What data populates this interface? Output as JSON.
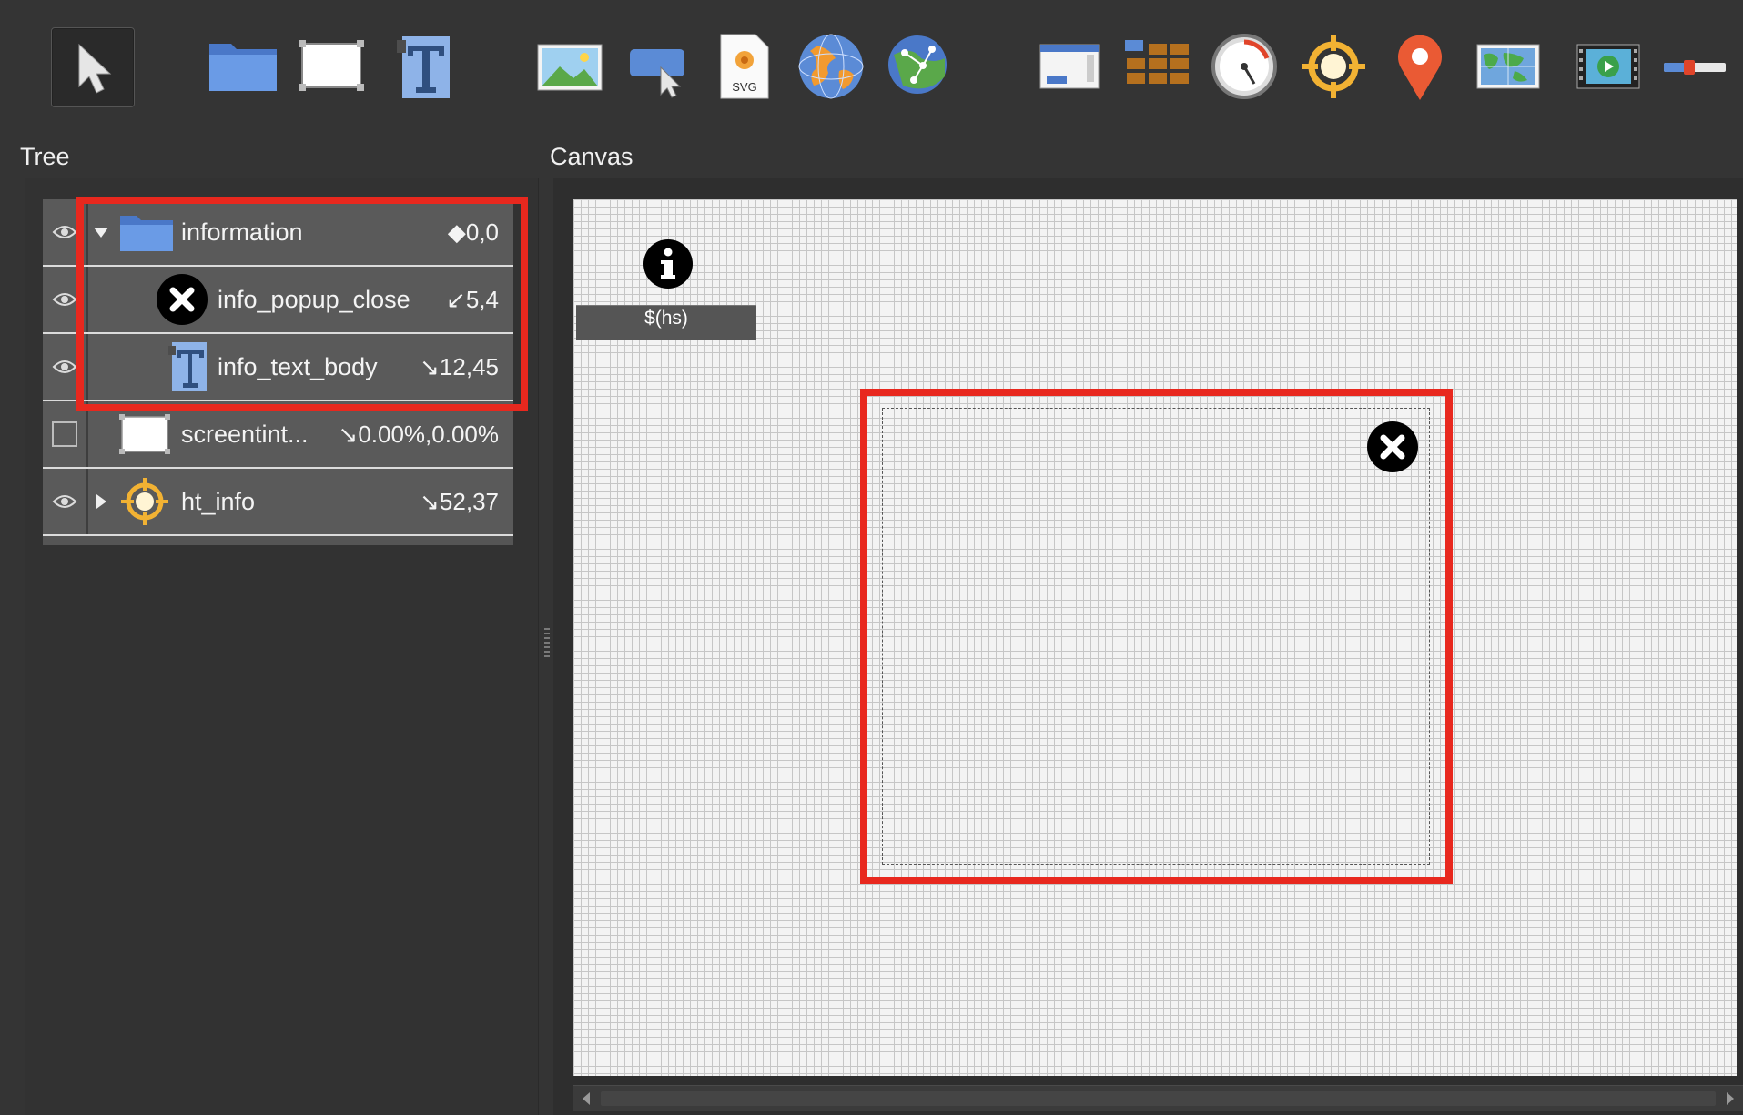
{
  "toolbar": {
    "tools": [
      {
        "name": "pointer-tool",
        "icon": "arrow-pointer-icon",
        "active": true
      },
      {
        "name": "folder-tool",
        "icon": "folder-icon"
      },
      {
        "name": "rectangle-tool",
        "icon": "rectangle-icon"
      },
      {
        "name": "text-tool",
        "icon": "text-icon"
      },
      {
        "name": "image-tool",
        "icon": "image-icon"
      },
      {
        "name": "button-tool",
        "icon": "button-click-icon"
      },
      {
        "name": "svg-tool",
        "icon": "svg-file-icon",
        "label": "SVG"
      },
      {
        "name": "globe-tool",
        "icon": "globe-icon"
      },
      {
        "name": "map-node-tool",
        "icon": "node-map-icon"
      },
      {
        "name": "window-tool",
        "icon": "window-icon"
      },
      {
        "name": "grid-tool",
        "icon": "grid-icon"
      },
      {
        "name": "gauge-tool",
        "icon": "gauge-icon"
      },
      {
        "name": "hotspot-tool",
        "icon": "crosshair-icon"
      },
      {
        "name": "pin-tool",
        "icon": "map-pin-icon"
      },
      {
        "name": "map-tool",
        "icon": "world-map-icon"
      },
      {
        "name": "video-tool",
        "icon": "video-icon"
      },
      {
        "name": "slider-tool",
        "icon": "slider-icon"
      }
    ]
  },
  "panels": {
    "tree_title": "Tree",
    "canvas_title": "Canvas"
  },
  "tree": {
    "rows": [
      {
        "label": "information",
        "coord": "◆0,0",
        "visible": true,
        "expander": "expanded",
        "icon": "folder-icon"
      },
      {
        "label": "info_popup_close",
        "coord": "↙5,4",
        "visible": true,
        "expander": "none",
        "icon": "close-icon"
      },
      {
        "label": "info_text_body",
        "coord": "↘12,45",
        "visible": true,
        "expander": "none",
        "icon": "text-icon"
      },
      {
        "label": "screentint...",
        "coord": "↘0.00%,0.00%",
        "visible": false,
        "expander": "none",
        "icon": "rectangle-icon"
      },
      {
        "label": "ht_info",
        "coord": "↘52,37",
        "visible": true,
        "expander": "collapsed",
        "icon": "crosshair-icon"
      }
    ]
  },
  "canvas": {
    "hotspot_label": "$(hs)",
    "info_icon": "info-icon",
    "close_icon": "close-icon"
  },
  "colors": {
    "highlight": "#e8281e",
    "background": "#343434",
    "row": "#5a5a5a",
    "folder_blue": "#5b8bd6"
  }
}
